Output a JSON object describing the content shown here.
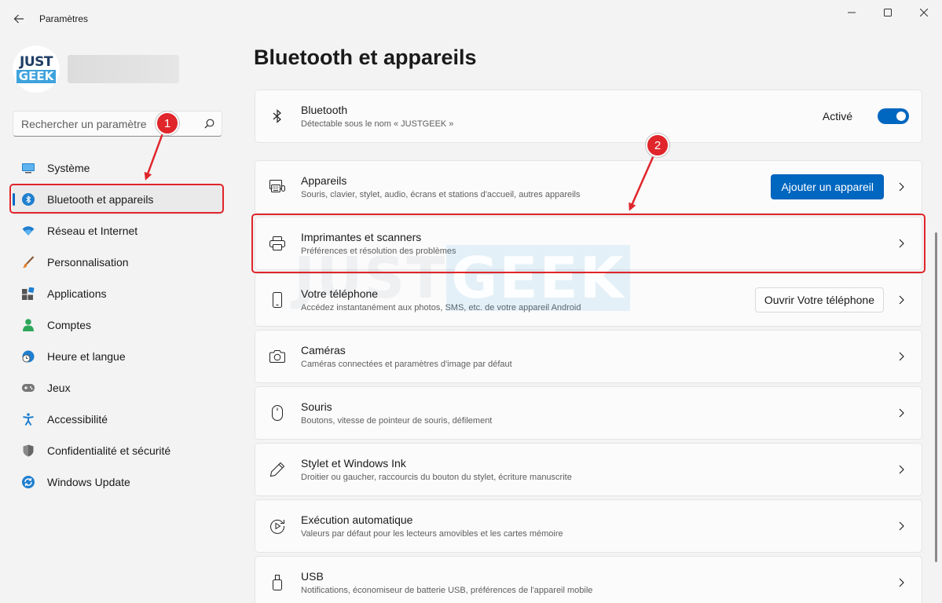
{
  "window": {
    "title": "Paramètres"
  },
  "profile": {
    "logo_line1": "JUST",
    "logo_line2": "GEEK"
  },
  "search": {
    "placeholder": "Rechercher un paramètre"
  },
  "sidebar": {
    "items": [
      {
        "label": "Système",
        "icon": "monitor-icon"
      },
      {
        "label": "Bluetooth et appareils",
        "icon": "bluetooth-icon",
        "active": true
      },
      {
        "label": "Réseau et Internet",
        "icon": "wifi-icon"
      },
      {
        "label": "Personnalisation",
        "icon": "brush-icon"
      },
      {
        "label": "Applications",
        "icon": "apps-icon"
      },
      {
        "label": "Comptes",
        "icon": "person-icon"
      },
      {
        "label": "Heure et langue",
        "icon": "clock-globe-icon"
      },
      {
        "label": "Jeux",
        "icon": "gamepad-icon"
      },
      {
        "label": "Accessibilité",
        "icon": "accessibility-icon"
      },
      {
        "label": "Confidentialité et sécurité",
        "icon": "shield-icon"
      },
      {
        "label": "Windows Update",
        "icon": "update-icon"
      }
    ]
  },
  "main": {
    "title": "Bluetooth et appareils",
    "cards": [
      {
        "title": "Bluetooth",
        "subtitle": "Détectable sous le nom « JUSTGEEK »",
        "icon": "bluetooth-icon",
        "toggle_label": "Activé",
        "toggle_on": true
      },
      {
        "title": "Appareils",
        "subtitle": "Souris, clavier, stylet, audio, écrans et stations d'accueil, autres appareils",
        "icon": "devices-icon",
        "button": "Ajouter un appareil"
      },
      {
        "title": "Imprimantes et scanners",
        "subtitle": "Préférences et résolution des problèmes",
        "icon": "printer-icon"
      },
      {
        "title": "Votre téléphone",
        "subtitle": "Accédez instantanément aux photos, SMS, etc. de votre appareil Android",
        "icon": "phone-icon",
        "button": "Ouvrir Votre téléphone"
      },
      {
        "title": "Caméras",
        "subtitle": "Caméras connectées et paramètres d'image par défaut",
        "icon": "camera-icon"
      },
      {
        "title": "Souris",
        "subtitle": "Boutons, vitesse de pointeur de souris, défilement",
        "icon": "mouse-icon"
      },
      {
        "title": "Stylet et Windows Ink",
        "subtitle": "Droitier ou gaucher, raccourcis du bouton du stylet, écriture manuscrite",
        "icon": "pen-icon"
      },
      {
        "title": "Exécution automatique",
        "subtitle": "Valeurs par défaut pour les lecteurs amovibles et les cartes mémoire",
        "icon": "autoplay-icon"
      },
      {
        "title": "USB",
        "subtitle": "Notifications, économiseur de batterie USB, préférences de l'appareil mobile",
        "icon": "usb-icon"
      }
    ]
  },
  "annotations": {
    "badge1": "1",
    "badge2": "2"
  },
  "watermark": {
    "part1": "JUST",
    "part2": "GEEK"
  },
  "colors": {
    "accent": "#0067c0",
    "annotation_red": "#e0252b",
    "background": "#f3f3f3",
    "card": "#fbfbfb"
  }
}
